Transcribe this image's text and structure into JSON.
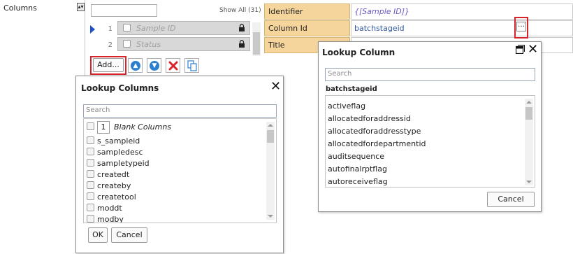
{
  "left": {
    "label": "Columns"
  },
  "column_list": {
    "show_all": "Show All (31)",
    "rows": [
      {
        "num": "1",
        "name": "Sample ID"
      },
      {
        "num": "2",
        "name": "Status"
      }
    ],
    "add_label": "Add..."
  },
  "properties": [
    {
      "label": "Identifier",
      "value": "{[Sample ID]}"
    },
    {
      "label": "Column Id",
      "value": "batchstageid"
    },
    {
      "label": "Title",
      "value": ""
    }
  ],
  "lookup_columns_dialog": {
    "title": "Lookup Columns",
    "search_placeholder": "Search",
    "blank_count": "1",
    "blank_label": "Blank Columns",
    "items": [
      "s_sampleid",
      "sampledesc",
      "sampletypeid",
      "createdt",
      "createby",
      "createtool",
      "moddt",
      "modby"
    ],
    "ok_label": "OK",
    "cancel_label": "Cancel"
  },
  "lookup_column_dialog": {
    "title": "Lookup Column",
    "search_placeholder": "Search",
    "selected": "batchstageid",
    "items": [
      "activeflag",
      "allocatedforaddressid",
      "allocatedforaddresstype",
      "allocatedfordepartmentid",
      "auditsequence",
      "autofinalrptflag",
      "autoreceiveflag"
    ],
    "cancel_label": "Cancel"
  },
  "colors": {
    "highlight": "#d8232a",
    "label_bg": "#f6d59c",
    "accent_blue": "#2b7fd0",
    "delete_red": "#d8232a"
  }
}
